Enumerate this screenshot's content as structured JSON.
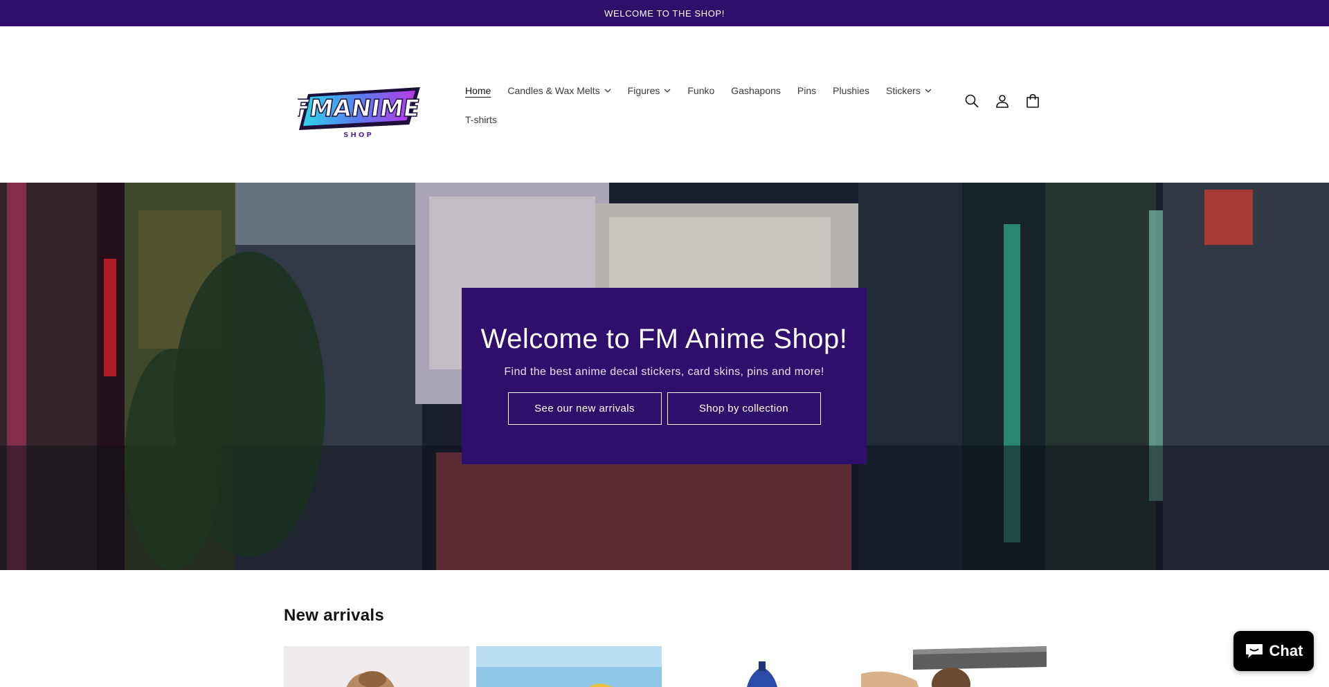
{
  "announcement": {
    "text": "WELCOME TO THE SHOP!"
  },
  "brand": {
    "logo_text": "FMANIME",
    "logo_sub": "SHOP"
  },
  "nav": {
    "items": [
      {
        "label": "Home",
        "active": true,
        "dropdown": false
      },
      {
        "label": "Candles & Wax Melts",
        "active": false,
        "dropdown": true
      },
      {
        "label": "Figures",
        "active": false,
        "dropdown": true
      },
      {
        "label": "Funko",
        "active": false,
        "dropdown": false
      },
      {
        "label": "Gashapons",
        "active": false,
        "dropdown": false
      },
      {
        "label": "Pins",
        "active": false,
        "dropdown": false
      },
      {
        "label": "Plushies",
        "active": false,
        "dropdown": false
      },
      {
        "label": "Stickers",
        "active": false,
        "dropdown": true
      },
      {
        "label": "T-shirts",
        "active": false,
        "dropdown": false
      }
    ]
  },
  "header_icons": [
    "search-icon",
    "account-icon",
    "cart-icon"
  ],
  "hero": {
    "title": "Welcome to FM Anime Shop!",
    "subtitle": "Find the best anime decal stickers, card skins, pins and more!",
    "button_primary": "See our new arrivals",
    "button_secondary": "Shop by collection"
  },
  "new_arrivals": {
    "title": "New arrivals"
  },
  "chat": {
    "label": "Chat"
  },
  "colors": {
    "brand_purple": "#2e0f6b",
    "text": "#121212",
    "white": "#ffffff"
  }
}
